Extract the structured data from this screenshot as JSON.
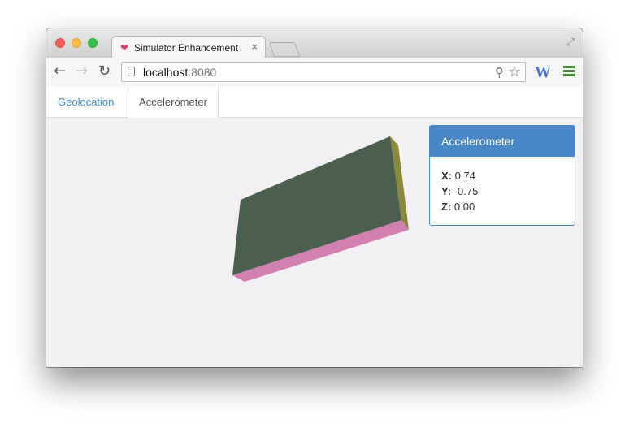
{
  "browser": {
    "tab_title": "Simulator Enhancement",
    "tab_close": "×",
    "favicon": "❤",
    "url_host": "localhost",
    "url_port": ":8080",
    "extension_label": "W"
  },
  "icons": {
    "back": "←",
    "forward": "→",
    "reload": "↻",
    "zoom": "⚲",
    "star": "☆",
    "fullscreen": "⤢"
  },
  "nav": {
    "tabs": [
      {
        "label": "Geolocation",
        "active": false
      },
      {
        "label": "Accelerometer",
        "active": true
      }
    ]
  },
  "accelerometer": {
    "title": "Accelerometer",
    "x_label": "X:",
    "x_value": "0.74",
    "y_label": "Y:",
    "y_value": "-0.75",
    "z_label": "Z:",
    "z_value": "0.00"
  },
  "colors": {
    "device_top": "#4a5f4d",
    "device_side": "#8c8a3a",
    "device_front": "#d27fb2",
    "panel_heading": "#4a87c6",
    "link": "#428bca"
  }
}
